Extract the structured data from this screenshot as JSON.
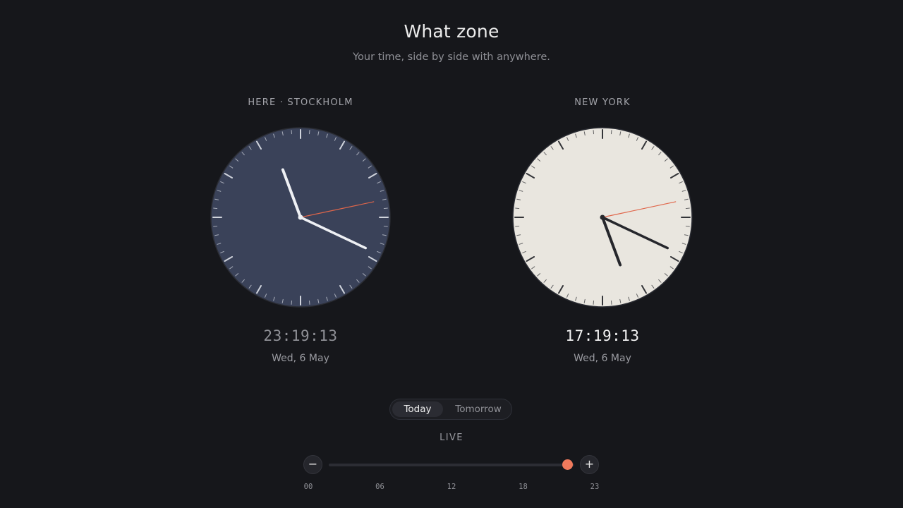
{
  "header": {
    "title": "What zone",
    "subtitle": "Your time, side by side with anywhere."
  },
  "clocks": [
    {
      "label": "HERE · STOCKHOLM",
      "time": "23:19:13",
      "date": "Wed, 6 May",
      "hour": 23,
      "minute": 19,
      "second": 13,
      "face_color": "#3a4259",
      "tick_color": "#d9dce4",
      "hand_color": "#eef0f4",
      "second_hand_color": "#e0664a"
    },
    {
      "label": "NEW YORK",
      "time": "17:19:13",
      "date": "Wed, 6 May",
      "hour": 17,
      "minute": 19,
      "second": 13,
      "face_color": "#e9e6df",
      "tick_color": "#2a2b30",
      "hand_color": "#26272c",
      "second_hand_color": "#e0664a"
    }
  ],
  "day_toggle": {
    "options": [
      "Today",
      "Tomorrow"
    ],
    "selected": "Today"
  },
  "status": "LIVE",
  "slider": {
    "minus_icon": "minus-icon",
    "plus_icon": "plus-icon",
    "value_hours": 23.32,
    "min_hours": 0,
    "max_hours": 24,
    "ticks": [
      "00",
      "06",
      "12",
      "18",
      "23"
    ],
    "thumb_color": "#f07a5c"
  }
}
